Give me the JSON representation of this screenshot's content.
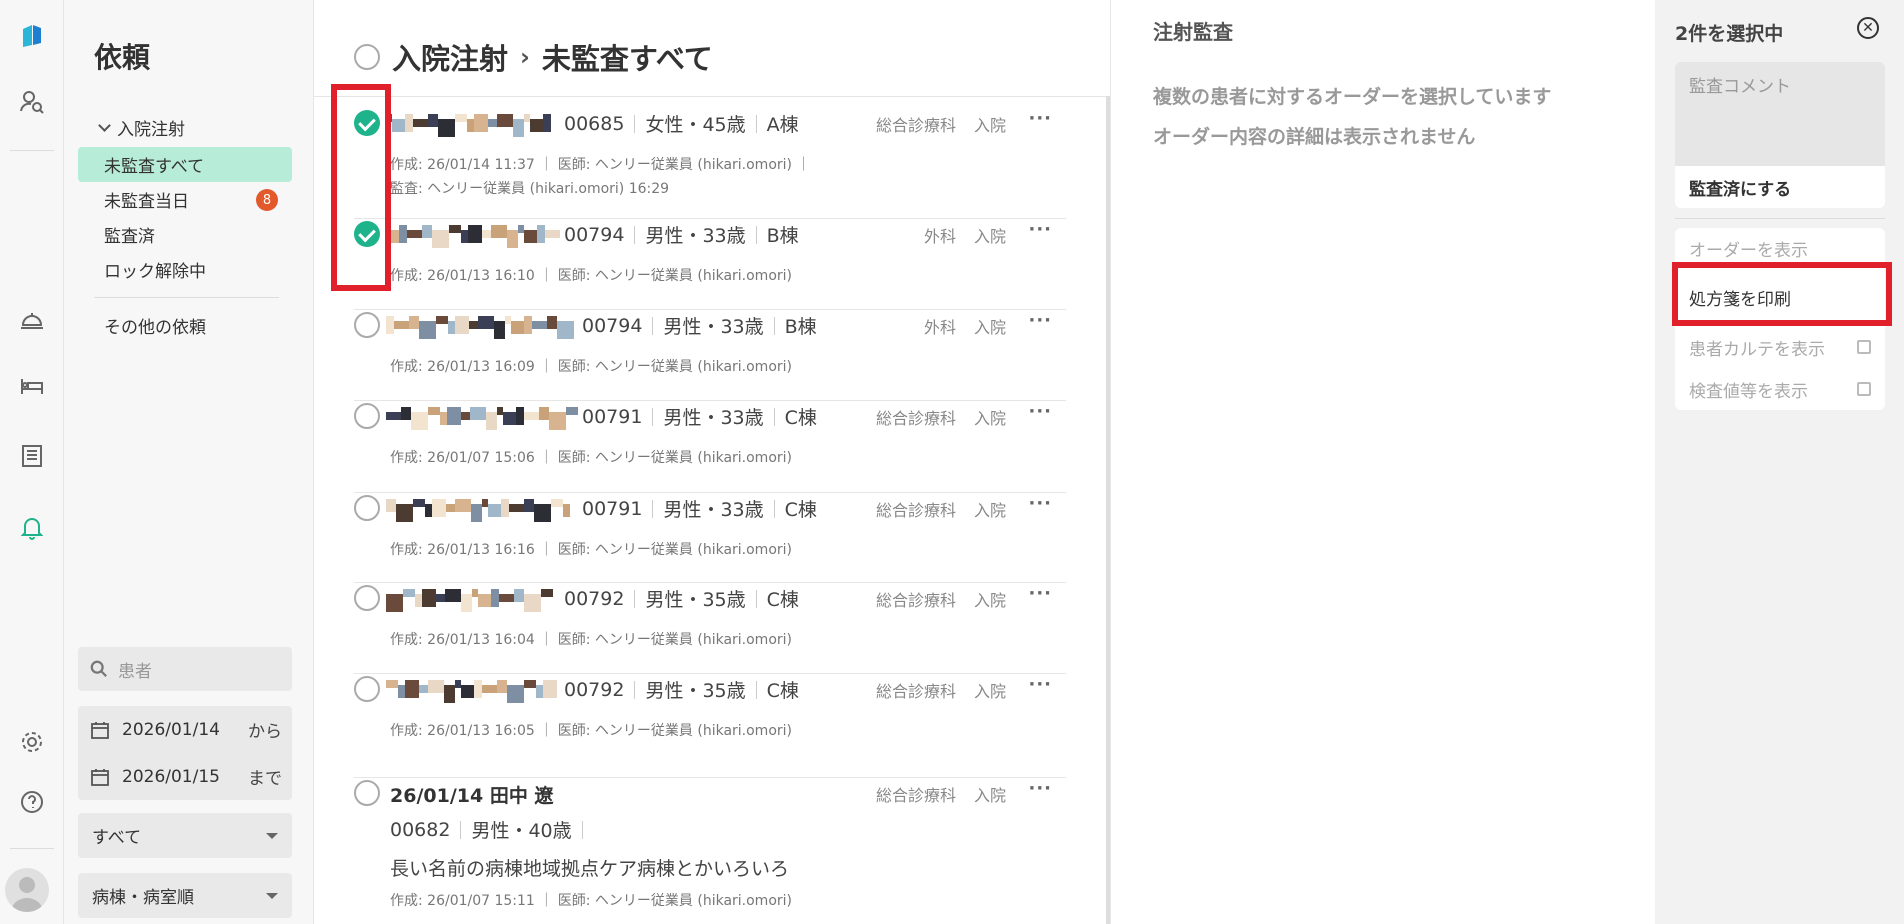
{
  "rail": {
    "icons": [
      "logo-icon",
      "user-search-icon",
      "bell-desk-icon",
      "bed-icon",
      "list-icon",
      "bell-icon",
      "gear-icon",
      "help-icon"
    ]
  },
  "sidebar": {
    "title": "依頼",
    "group": "入院注射",
    "items": [
      {
        "label": "未監査すべて"
      },
      {
        "label": "未監査当日",
        "badge": "8"
      },
      {
        "label": "監査済"
      },
      {
        "label": "ロック解除中"
      }
    ],
    "other": "その他の依頼",
    "search_placeholder": "患者",
    "date_from": "2026/01/14",
    "date_from_suffix": "から",
    "date_to": "2026/01/15",
    "date_to_suffix": "まで",
    "filter": "すべて",
    "sort": "病棟・病室順"
  },
  "main": {
    "breadcrumb_parent": "入院注射",
    "breadcrumb_sep": "›",
    "breadcrumb_current": "未監査すべて",
    "rows": [
      {
        "checked": true,
        "id": "00685",
        "sex_age": "女性・45歳",
        "ward": "A棟",
        "dept": "総合診療科",
        "type": "入院",
        "meta1": "作成: 26/01/14 11:37 ｜ 医師: ヘンリー従業員 (hikari.omori) ｜",
        "meta2": "監査: ヘンリー従業員 (hikari.omori) 16:29"
      },
      {
        "checked": true,
        "id": "00794",
        "sex_age": "男性・33歳",
        "ward": "B棟",
        "dept": "外科",
        "type": "入院",
        "meta1": "作成: 26/01/13 16:10 ｜ 医師: ヘンリー従業員 (hikari.omori)"
      },
      {
        "checked": false,
        "id": "00794",
        "sex_age": "男性・33歳",
        "ward": "B棟",
        "dept": "外科",
        "type": "入院",
        "meta1": "作成: 26/01/13 16:09 ｜ 医師: ヘンリー従業員 (hikari.omori)"
      },
      {
        "checked": false,
        "id": "00791",
        "sex_age": "男性・33歳",
        "ward": "C棟",
        "dept": "総合診療科",
        "type": "入院",
        "meta1": "作成: 26/01/07 15:06 ｜ 医師: ヘンリー従業員 (hikari.omori)"
      },
      {
        "checked": false,
        "id": "00791",
        "sex_age": "男性・33歳",
        "ward": "C棟",
        "dept": "総合診療科",
        "type": "入院",
        "meta1": "作成: 26/01/13 16:16 ｜ 医師: ヘンリー従業員 (hikari.omori)"
      },
      {
        "checked": false,
        "id": "00792",
        "sex_age": "男性・35歳",
        "ward": "C棟",
        "dept": "総合診療科",
        "type": "入院",
        "meta1": "作成: 26/01/13 16:04 ｜ 医師: ヘンリー従業員 (hikari.omori)"
      },
      {
        "checked": false,
        "id": "00792",
        "sex_age": "男性・35歳",
        "ward": "C棟",
        "dept": "総合診療科",
        "type": "入院",
        "meta1": "作成: 26/01/13 16:05 ｜ 医師: ヘンリー従業員 (hikari.omori)"
      }
    ],
    "last_row": {
      "name": "26/01/14 田中 遼",
      "id": "00682",
      "sex_age": "男性・40歳",
      "ward": "長い名前の病棟地域拠点ケア病棟とかいろいろ",
      "dept": "総合診療科",
      "type": "入院",
      "meta1": "作成: 26/01/07 15:11 ｜ 医師: ヘンリー従業員 (hikari.omori)"
    },
    "more": "···"
  },
  "detail": {
    "title": "注射監査",
    "msg1": "複数の患者に対するオーダーを選択しています",
    "msg2": "オーダー内容の詳細は表示されません"
  },
  "right": {
    "title": "2件を選択中",
    "comment_placeholder": "監査コメント",
    "audit_button": "監査済にする",
    "menu": [
      "オーダーを表示",
      "処方箋を印刷",
      "患者カルテを表示",
      "検査値等を表示"
    ]
  },
  "colors": {
    "accent": "#1eb38a",
    "active_bg": "#b6ecd8",
    "badge": "#e25a2c",
    "highlight": "#e0202a"
  }
}
